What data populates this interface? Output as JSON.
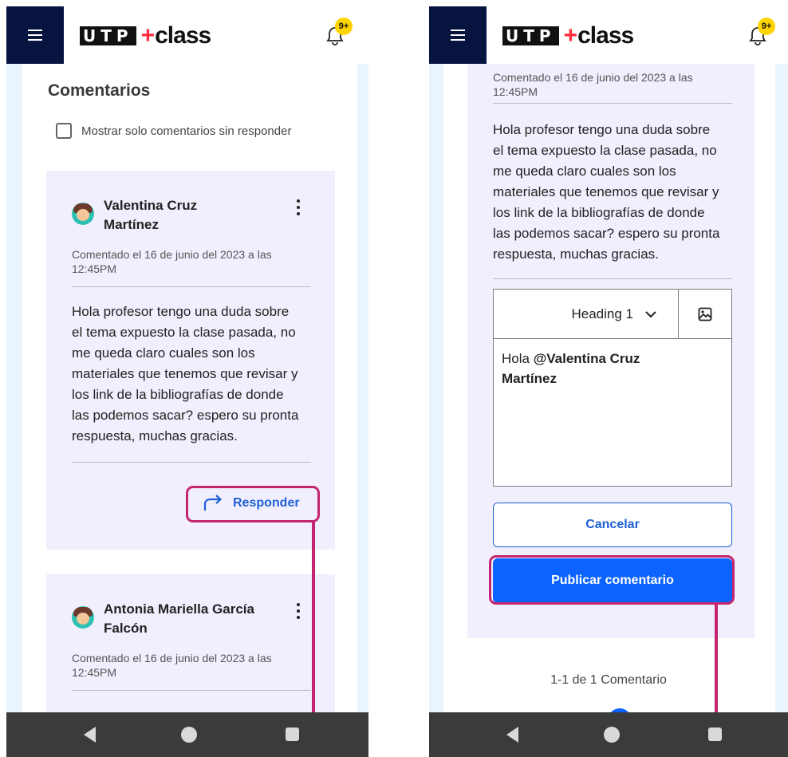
{
  "app": {
    "logo_letters": [
      "U",
      "T",
      "P"
    ],
    "logo_plus": "+",
    "logo_class": "class",
    "notification_badge": "9+",
    "brand_color": "#0d63ff",
    "header_dark": "#071440"
  },
  "left": {
    "title": "Comentarios",
    "filter_label": "Mostrar solo comentarios sin responder",
    "filter_checked": false,
    "comments": [
      {
        "author_line1": "Valentina Cruz",
        "author_line2": "Martínez",
        "date_line1": "Comentado el 16 de junio del 2023 a las",
        "date_line2": "12:45PM",
        "body_lines": [
          "Hola profesor tengo una duda sobre",
          "el tema expuesto la clase pasada, no",
          "me queda claro cuales son los",
          "materiales que tenemos que revisar y",
          "los link de la bibliografías de donde",
          "las podemos sacar? espero su pronta",
          "respuesta, muchas gracias."
        ],
        "reply_label": "Responder"
      },
      {
        "author_line1": "Antonia Mariella García",
        "author_line2": "Falcón",
        "date_line1": "Comentado el 16 de junio del 2023 a las",
        "date_line2": "12:45PM"
      }
    ]
  },
  "right": {
    "date_line1": "Comentado el 16 de junio del 2023 a las",
    "date_line2": "12:45PM",
    "body_lines": [
      "Hola profesor tengo una duda sobre",
      "el tema expuesto la clase pasada, no",
      "me queda claro cuales son los",
      "materiales que tenemos que revisar y",
      "los link de la bibliografías de donde",
      "las podemos sacar? espero su pronta",
      "respuesta, muchas gracias."
    ],
    "editor": {
      "heading_label": "Heading 1",
      "reply_prefix": "Hola ",
      "mention_line1": "@Valentina Cruz",
      "mention_line2": "Martínez"
    },
    "cancel_label": "Cancelar",
    "publish_label": "Publicar comentario",
    "pagination_text": "1-1 de 1 Comentario"
  }
}
